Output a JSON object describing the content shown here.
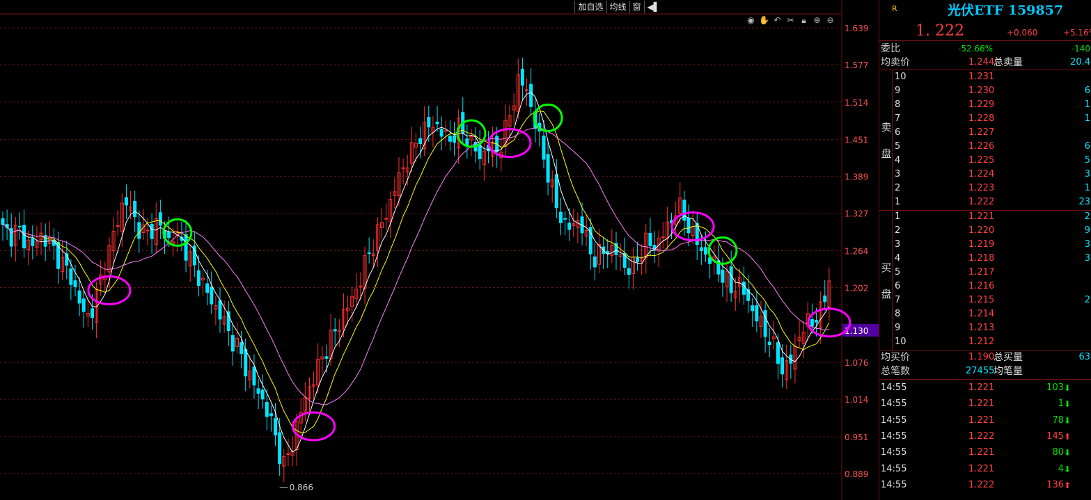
{
  "toolbar": {
    "buttons": [
      "加自选",
      "均线",
      "窗"
    ],
    "icons": [
      "eye-icon",
      "hand-icon",
      "undo-icon",
      "scissors-icon",
      "lock-icon",
      "zoom-in-icon",
      "zoom-out-icon"
    ]
  },
  "colors": {
    "up": "#ff3030",
    "down": "#00e5ff",
    "ma_short": "#ffffff",
    "ma_mid": "#ffff00",
    "ma_long": "#ff80ff",
    "grid": "#5a1414",
    "axis_text": "#ff5050",
    "current_price_bg": "#5000a0",
    "circle_magenta": "#ff00ff",
    "circle_green": "#00ff00"
  },
  "price_axis": {
    "labels": [
      "1.639",
      "1.577",
      "1.514",
      "1.451",
      "1.389",
      "1.327",
      "1.264",
      "1.202",
      "1.130",
      "1.076",
      "1.014",
      "0.951",
      "0.889"
    ],
    "current_label": "1.130",
    "range": [
      0.866,
      1.639
    ]
  },
  "chart_data": {
    "type": "candlestick",
    "low_marker": "0.866",
    "series_close": [
      1.3,
      1.29,
      1.3,
      1.28,
      1.27,
      1.29,
      1.28,
      1.26,
      1.24,
      1.22,
      1.18,
      1.15,
      1.17,
      1.22,
      1.26,
      1.31,
      1.35,
      1.33,
      1.3,
      1.29,
      1.31,
      1.3,
      1.28,
      1.29,
      1.27,
      1.24,
      1.22,
      1.19,
      1.17,
      1.15,
      1.12,
      1.1,
      1.07,
      1.04,
      1.02,
      0.99,
      0.95,
      0.9,
      0.93,
      0.98,
      1.02,
      1.05,
      1.08,
      1.11,
      1.13,
      1.16,
      1.18,
      1.21,
      1.25,
      1.28,
      1.31,
      1.34,
      1.38,
      1.41,
      1.43,
      1.46,
      1.47,
      1.48,
      1.46,
      1.45,
      1.47,
      1.46,
      1.44,
      1.42,
      1.44,
      1.43,
      1.45,
      1.5,
      1.55,
      1.54,
      1.49,
      1.44,
      1.39,
      1.34,
      1.31,
      1.3,
      1.32,
      1.28,
      1.25,
      1.26,
      1.27,
      1.26,
      1.24,
      1.23,
      1.26,
      1.28,
      1.27,
      1.29,
      1.31,
      1.34,
      1.32,
      1.29,
      1.27,
      1.25,
      1.24,
      1.22,
      1.2,
      1.21,
      1.19,
      1.16,
      1.14,
      1.12,
      1.09,
      1.06,
      1.08,
      1.12,
      1.14,
      1.15,
      1.16,
      1.22
    ],
    "annotations": [
      {
        "kind": "ellipse",
        "color": "magenta",
        "at_index": 14
      },
      {
        "kind": "ellipse",
        "color": "green",
        "at_index": 23
      },
      {
        "kind": "ellipse",
        "color": "magenta",
        "at_index": 41
      },
      {
        "kind": "ellipse",
        "color": "green",
        "at_index": 62
      },
      {
        "kind": "ellipse",
        "color": "magenta",
        "at_index": 67
      },
      {
        "kind": "ellipse",
        "color": "green",
        "at_index": 72
      },
      {
        "kind": "ellipse",
        "color": "magenta",
        "at_index": 91
      },
      {
        "kind": "ellipse",
        "color": "green",
        "at_index": 95
      },
      {
        "kind": "ellipse",
        "color": "magenta",
        "at_index": 118
      }
    ]
  },
  "panel": {
    "r_badge": "R",
    "title": "光伏ETF 159857",
    "price": "1. 222",
    "change": "+0.060",
    "change_pct": "+5.16%",
    "weibi_label": "委比",
    "weibi_pct": "-52.66%",
    "weibi_val": "-140",
    "avg_sell_label": "均卖价",
    "avg_sell": "1.244",
    "total_sell_label": "总卖量",
    "total_sell": "20.4",
    "sell_side_label": [
      "卖",
      "盘"
    ],
    "sells": [
      {
        "lvl": "10",
        "price": "1.231",
        "vol": ""
      },
      {
        "lvl": "9",
        "price": "1.230",
        "vol": "6"
      },
      {
        "lvl": "8",
        "price": "1.229",
        "vol": "1"
      },
      {
        "lvl": "7",
        "price": "1.228",
        "vol": "1"
      },
      {
        "lvl": "6",
        "price": "1.227",
        "vol": ""
      },
      {
        "lvl": "5",
        "price": "1.226",
        "vol": "6"
      },
      {
        "lvl": "4",
        "price": "1.225",
        "vol": "5"
      },
      {
        "lvl": "3",
        "price": "1.224",
        "vol": "3"
      },
      {
        "lvl": "2",
        "price": "1.223",
        "vol": "1"
      },
      {
        "lvl": "1",
        "price": "1.222",
        "vol": "23"
      }
    ],
    "buy_side_label": [
      "买",
      "盘"
    ],
    "buys": [
      {
        "lvl": "1",
        "price": "1.221",
        "vol": "2"
      },
      {
        "lvl": "2",
        "price": "1.220",
        "vol": "9"
      },
      {
        "lvl": "3",
        "price": "1.219",
        "vol": "3"
      },
      {
        "lvl": "4",
        "price": "1.218",
        "vol": "3"
      },
      {
        "lvl": "5",
        "price": "1.217",
        "vol": ""
      },
      {
        "lvl": "6",
        "price": "1.216",
        "vol": ""
      },
      {
        "lvl": "7",
        "price": "1.215",
        "vol": "2"
      },
      {
        "lvl": "8",
        "price": "1.214",
        "vol": ""
      },
      {
        "lvl": "9",
        "price": "1.213",
        "vol": ""
      },
      {
        "lvl": "10",
        "price": "1.212",
        "vol": ""
      }
    ],
    "avg_buy_label": "均买价",
    "avg_buy": "1.190",
    "total_buy_label": "总买量",
    "total_buy": "63",
    "total_trades_label": "总笔数",
    "total_trades": "27455",
    "avg_trade_label": "均笔量",
    "ticks": [
      {
        "time": "14:55",
        "price": "1.221",
        "vol": "103",
        "dir": "down"
      },
      {
        "time": "14:55",
        "price": "1.221",
        "vol": "1",
        "dir": "down"
      },
      {
        "time": "14:55",
        "price": "1.221",
        "vol": "78",
        "dir": "down"
      },
      {
        "time": "14:55",
        "price": "1.222",
        "vol": "145",
        "dir": "up"
      },
      {
        "time": "14:55",
        "price": "1.221",
        "vol": "80",
        "dir": "down"
      },
      {
        "time": "14:55",
        "price": "1.221",
        "vol": "4",
        "dir": "down"
      },
      {
        "time": "14:55",
        "price": "1.222",
        "vol": "136",
        "dir": "up"
      }
    ]
  }
}
